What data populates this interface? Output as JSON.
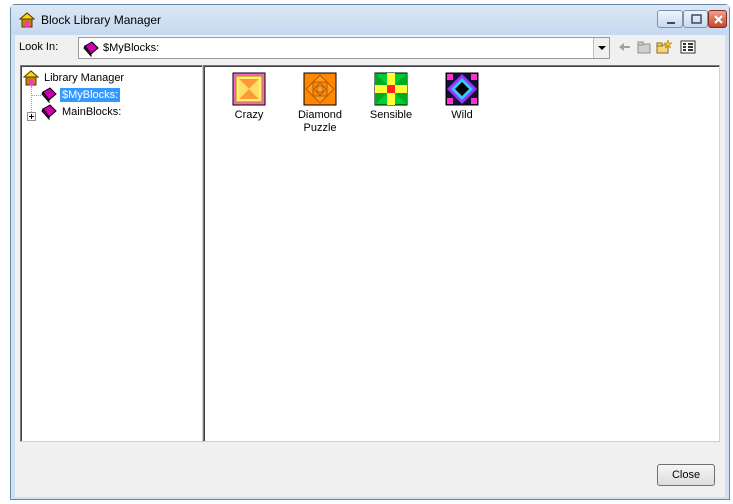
{
  "window": {
    "title": "Block Library Manager",
    "icon": "house-icon"
  },
  "title_buttons": {
    "minimize_icon": "minimize-icon",
    "maximize_icon": "maximize-icon",
    "close_icon": "close-icon"
  },
  "look_in": {
    "label": "Look In:",
    "value": "$MyBlocks:",
    "value_icon": "block-library-icon"
  },
  "toolbar": {
    "back_icon": "back-arrow-icon",
    "up_icon": "up-folder-icon",
    "new_folder_icon": "new-folder-icon",
    "view_icon": "view-menu-icon"
  },
  "tree": {
    "root": {
      "label": "Library Manager",
      "icon": "house-icon"
    },
    "items": [
      {
        "label": "$MyBlocks:",
        "icon": "block-library-icon",
        "selected": true
      },
      {
        "label": "MainBlocks:",
        "icon": "block-library-icon",
        "selected": false
      }
    ]
  },
  "blocks": [
    {
      "label": "Crazy",
      "icon": "crazy-block-icon"
    },
    {
      "label": "Diamond\nPuzzle",
      "icon": "diamond-puzzle-block-icon"
    },
    {
      "label": "Sensible",
      "icon": "sensible-block-icon"
    },
    {
      "label": "Wild",
      "icon": "wild-block-icon"
    }
  ],
  "buttons": {
    "close_label": "Close"
  },
  "colors": {
    "selection": "#3399ff",
    "titlebar": "#c4d8ef",
    "close_button_red": "#c8442a"
  }
}
